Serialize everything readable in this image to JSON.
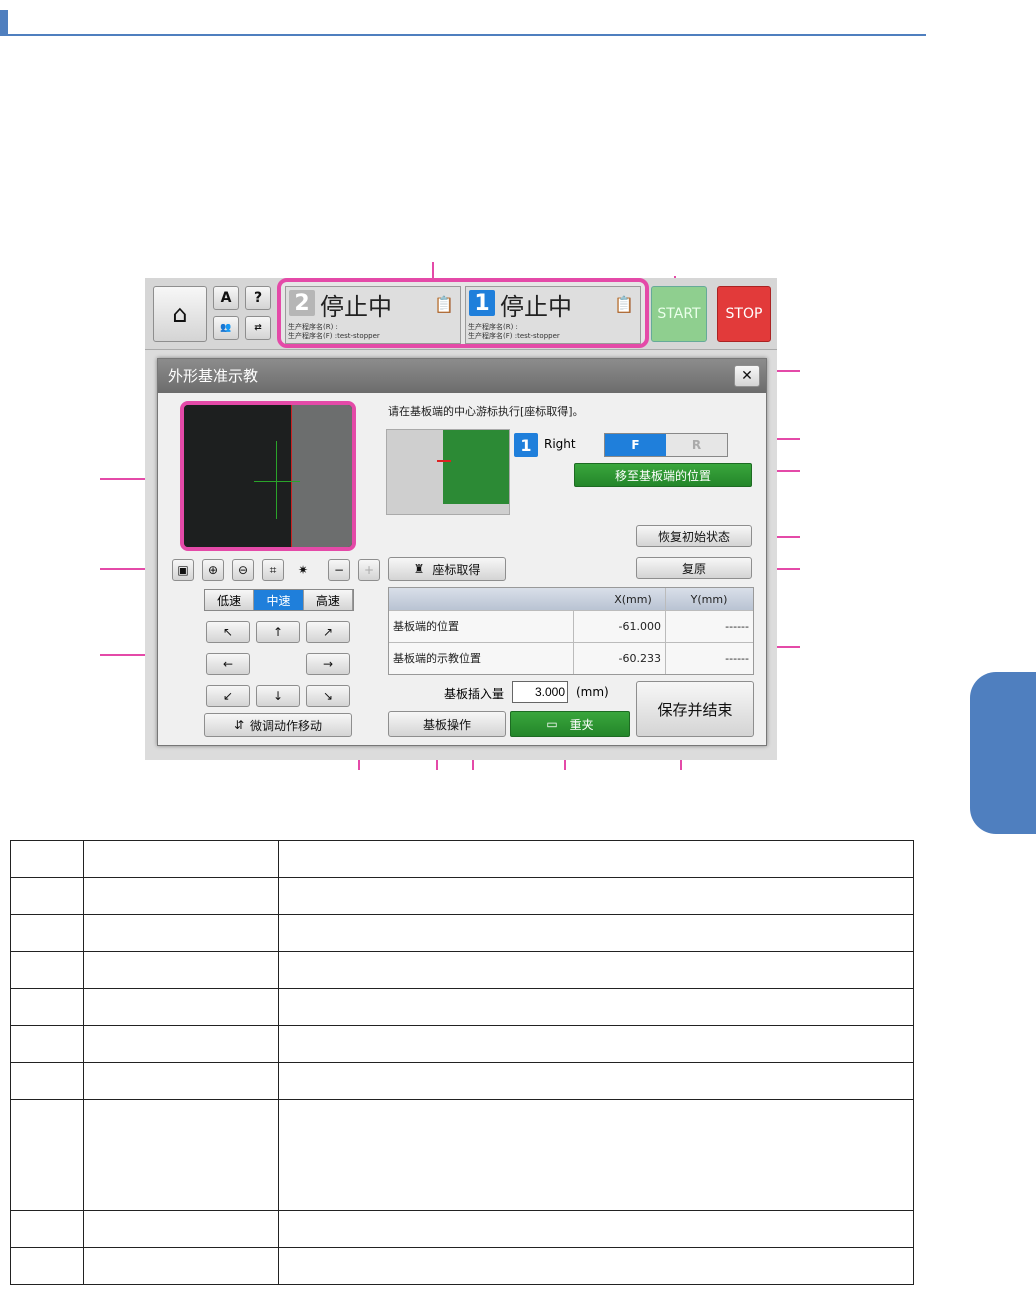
{
  "colors": {
    "accent": "#4f7fbf",
    "callout": "#e44aa8",
    "start": "#8fcf8f",
    "stop": "#e23a3a",
    "green_btn": "#2a8f2f",
    "seg_selected": "#1f7fdb"
  },
  "topbar": {
    "home_icon": "home-icon",
    "sm_buttons": [
      "A",
      "?"
    ],
    "lane2": {
      "number": "2",
      "state": "停止中",
      "prog_r": "生产程序名(R) :",
      "prog_f": "生产程序名(F) :test-stopper"
    },
    "lane1": {
      "number": "1",
      "state": "停止中",
      "prog_r": "生产程序名(R) :",
      "prog_f": "生产程序名(F) :test-stopper"
    },
    "start": "START",
    "stop": "STOP"
  },
  "dialog": {
    "title": "外形基准示教",
    "close": "✕",
    "instruction": "请在基板端的中心游标执行[座标取得]。",
    "lane_number": "1",
    "lane_side": "Right",
    "seg_f": "F",
    "seg_r": "R",
    "move_button": "移至基板端的位置",
    "reset_init_button": "恢复初始状态",
    "restore_button": "复原",
    "coord_button": "座标取得",
    "speed": [
      "低速",
      "中速",
      "高速"
    ],
    "speed_selected": 1,
    "fine_move_button": "微调动作移动",
    "table": {
      "headers": [
        "",
        "X(mm)",
        "Y(mm)"
      ],
      "rows": [
        {
          "label": "基板端的位置",
          "x": "-61.000",
          "y": "------"
        },
        {
          "label": "基板端的示教位置",
          "x": "-60.233",
          "y": "------"
        }
      ]
    },
    "insert_label": "基板插入量",
    "insert_value": "3.000",
    "insert_unit": "(mm)",
    "board_op_button": "基板操作",
    "reclamp_button": "重夹",
    "save_button": "保存并结束",
    "minus": "−",
    "plus": "+"
  },
  "lower_table": {
    "rows": 10
  }
}
